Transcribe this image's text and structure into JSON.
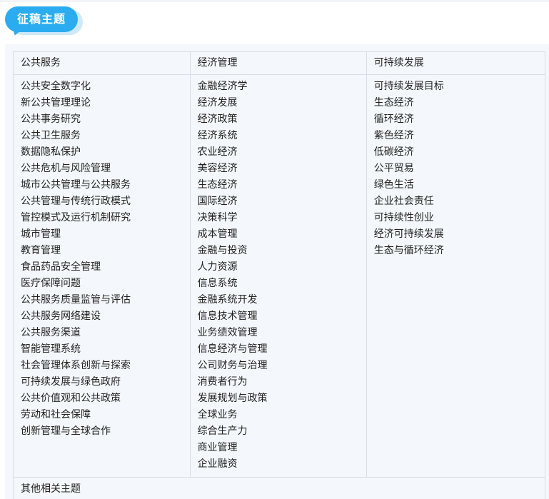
{
  "section": {
    "title": "征稿主题"
  },
  "colors": {
    "accent": "#2bacf0",
    "panel_bg": "#f4f8fc",
    "border": "#d6dde6"
  },
  "table": {
    "columns": [
      {
        "header": "公共服务",
        "items": [
          "公共安全数字化",
          "新公共管理理论",
          "公共事务研究",
          "公共卫生服务",
          "数据隐私保护",
          "公共危机与风险管理",
          "城市公共管理与公共服务",
          "公共管理与传统行政模式",
          "管控模式及运行机制研究",
          "城市管理",
          "教育管理",
          "食品药品安全管理",
          "医疗保障问题",
          "公共服务质量监管与评估",
          "公共服务网络建设",
          "公共服务渠道",
          "智能管理系统",
          "社会管理体系创新与探索",
          "可持续发展与绿色政府",
          "公共价值观和公共政策",
          "劳动和社会保障",
          "创新管理与全球合作"
        ]
      },
      {
        "header": "经济管理",
        "items": [
          "金融经济学",
          "经济发展",
          "经济政策",
          "经济系统",
          "农业经济",
          "美容经济",
          "生态经济",
          "国际经济",
          "决策科学",
          "成本管理",
          "金融与投资",
          "人力资源",
          "信息系统",
          "金融系统开发",
          "信息技术管理",
          "业务绩效管理",
          "信息经济与管理",
          "公司财务与治理",
          "消费者行为",
          "发展规划与政策",
          "全球业务",
          "综合生产力",
          "商业管理",
          "企业融资"
        ]
      },
      {
        "header": "可持续发展",
        "items": [
          "可持续发展目标",
          "生态经济",
          "循环经济",
          "紫色经济",
          "低碳经济",
          "公平贸易",
          "绿色生活",
          "企业社会责任",
          "可持续性创业",
          "经济可持续发展",
          "生态与循环经济"
        ]
      }
    ],
    "footer": "其他相关主题"
  }
}
